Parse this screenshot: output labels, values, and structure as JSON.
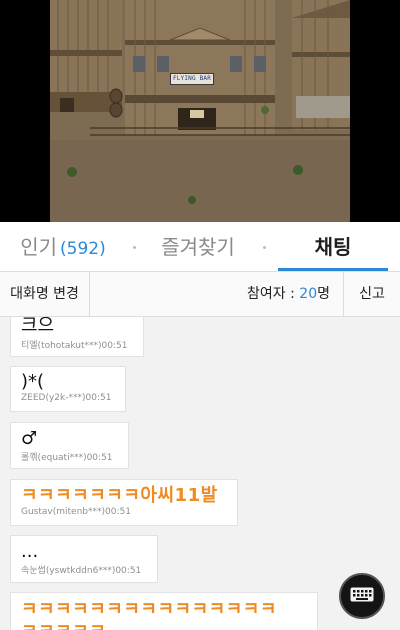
{
  "video": {
    "sign_text": "FLYING BAR"
  },
  "tabs": {
    "popular_label": "인기",
    "popular_count": "(592)",
    "favorites_label": "즐겨찾기",
    "chat_label": "채팅",
    "active": "채팅",
    "accent_color": "#2b88d8"
  },
  "toolbar": {
    "rename_label": "대화명 변경",
    "participants_label": "참여자 : ",
    "participants_count": "20",
    "participants_unit": "명",
    "report_label": "신고"
  },
  "messages": [
    {
      "text": "크으",
      "meta": "티엘(tohotakut***)00:51"
    },
    {
      "text": ")*(",
      "meta": "ZEED(y2k-***)00:51"
    },
    {
      "text": "♂",
      "meta": "롤껚(equati***)00:51"
    },
    {
      "text": "ㅋㅋㅋㅋㅋㅋㅋ아씨11발",
      "meta": "Gustav(mitenb***)00:51",
      "color": "#f08a24"
    },
    {
      "text": "...",
      "meta": "속눈썹(yswtkddn6***)00:51"
    },
    {
      "text": "ㅋㅋㅋㅋㅋㅋㅋㅋㅋㅋㅋㅋㅋㅋㅋ",
      "text2": "ㅋㅋㅋㅋㅋ",
      "color": "#f08a24"
    }
  ],
  "icons": {
    "keyboard": "keyboard-icon"
  }
}
